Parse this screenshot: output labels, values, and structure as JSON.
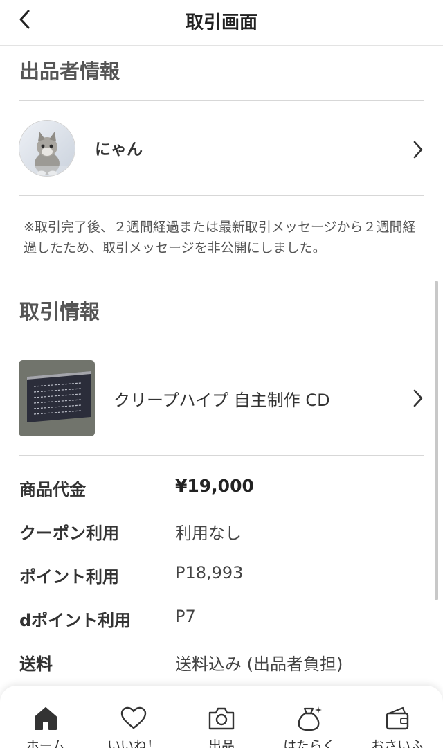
{
  "header": {
    "title": "取引画面"
  },
  "seller_section": {
    "title": "出品者情報",
    "seller_name": "にゃん"
  },
  "notice": "※取引完了後、２週間経過または最新取引メッセージから２週間経過したため、取引メッセージを非公開にしました。",
  "trade_section": {
    "title": "取引情報",
    "item_name": "クリープハイプ 自主制作 CD"
  },
  "info_rows": [
    {
      "label": "商品代金",
      "value": "¥19,000"
    },
    {
      "label": "クーポン利用",
      "value": "利用なし"
    },
    {
      "label": "ポイント利用",
      "value": "P18,993"
    },
    {
      "label": "dポイント利用",
      "value": "P7"
    },
    {
      "label": "送料",
      "value": "送料込み (出品者負担)"
    }
  ],
  "bottom_nav": [
    {
      "label": "ホーム",
      "icon": "home-icon"
    },
    {
      "label": "いいね！",
      "icon": "heart-icon"
    },
    {
      "label": "出品",
      "icon": "camera-icon"
    },
    {
      "label": "はたらく",
      "icon": "money-bag-icon"
    },
    {
      "label": "おさいふ",
      "icon": "wallet-icon"
    }
  ]
}
